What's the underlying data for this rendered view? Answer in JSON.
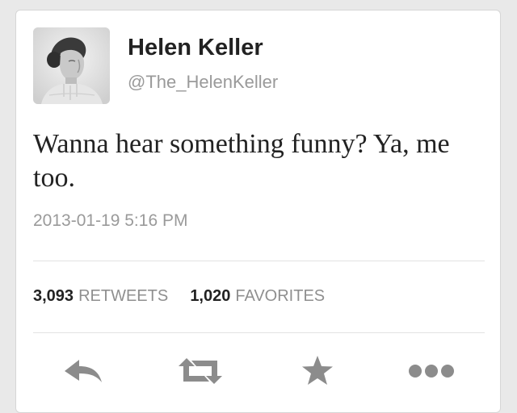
{
  "tweet": {
    "author_name": "Helen Keller",
    "author_handle": "@The_HelenKeller",
    "text": "Wanna hear something funny? Ya, me too.",
    "timestamp": "2013-01-19 5:16 PM",
    "retweet_count": "3,093",
    "retweet_label": "RETWEETS",
    "favorite_count": "1,020",
    "favorite_label": "FAVORITES"
  },
  "actions": {
    "reply_icon": "reply-arrow",
    "retweet_icon": "retweet-arrows",
    "favorite_icon": "star",
    "more_icon": "three-dots"
  },
  "colors": {
    "background": "#e9e9e9",
    "card": "#ffffff",
    "text_primary": "#222222",
    "text_secondary": "#9a9a9a",
    "icon": "#8c8c8c"
  }
}
